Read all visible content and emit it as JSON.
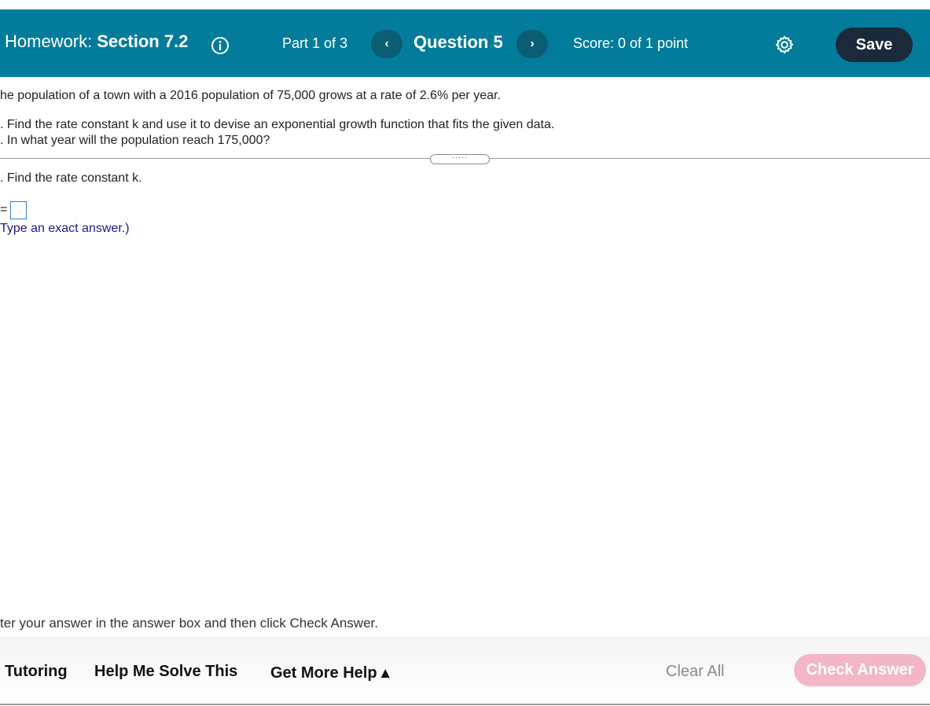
{
  "header": {
    "homework_prefix": "Homework:",
    "section_title": "Section 7.2",
    "part_text": "Part 1 of 3",
    "prev_label": "‹",
    "question_title": "Question 5",
    "next_label": "›",
    "score_text": "Score: 0 of 1 point",
    "save_label": "Save",
    "bar_color": "#037c9b"
  },
  "problem": {
    "intro": "he population of a town with a 2016 population of 75,000 grows at a rate of 2.6% per year.",
    "item_a": ". Find the rate constant k and use it to devise an exponential growth function that fits the given data.",
    "item_b": ". In what year will the population reach 175,000?",
    "handle_label": "·····"
  },
  "part_a": {
    "prompt": ". Find the rate constant k.",
    "equals": "=",
    "answer_value": "",
    "hint": "Type an exact answer.)"
  },
  "instruction": "ter your answer in the answer box and then click Check Answer.",
  "footer": {
    "tutoring_label": "Tutoring",
    "help_me_solve_label": "Help Me Solve This",
    "get_more_help_label": "Get More Help ▴",
    "clear_all_label": "Clear All",
    "check_answer_label": "Check Answer",
    "check_answer_color": "#f2b6c5"
  }
}
